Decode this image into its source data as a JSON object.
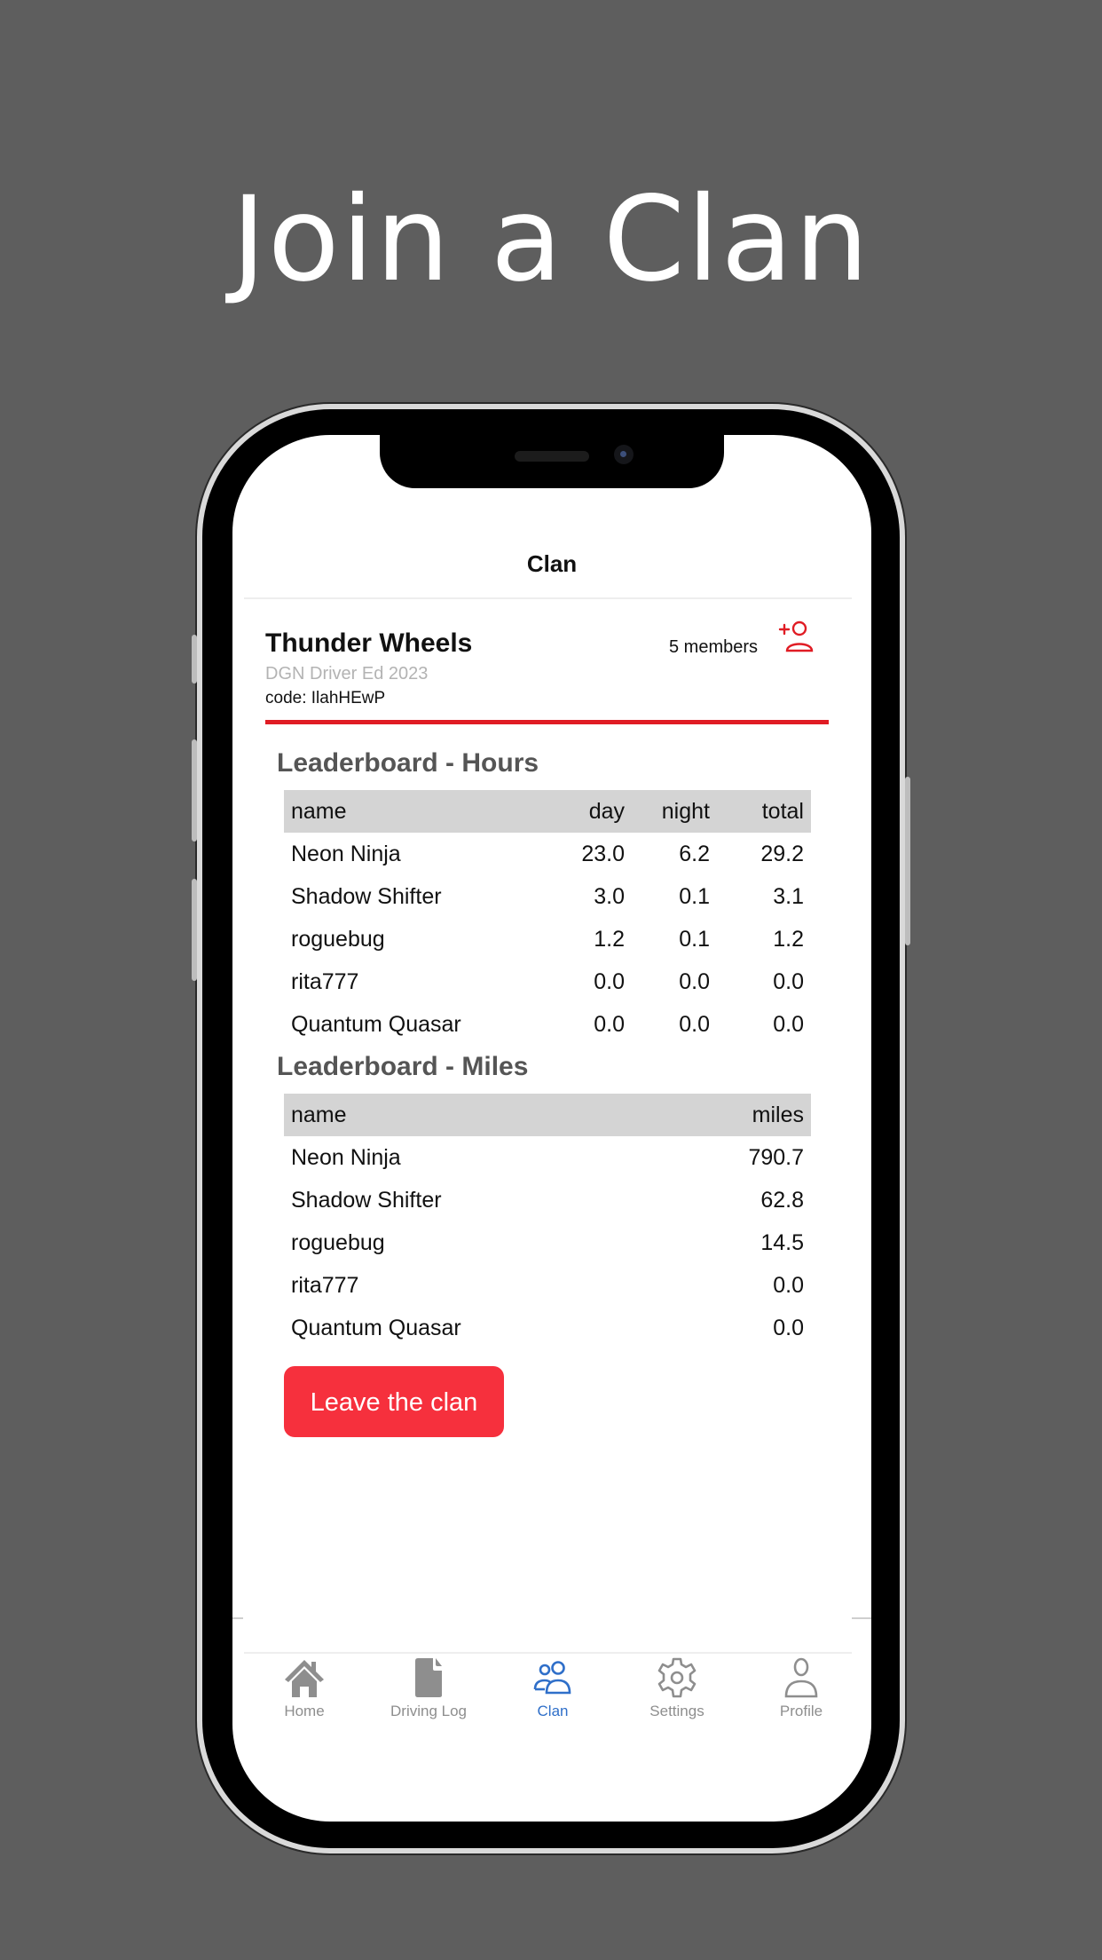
{
  "headline": "Join a Clan",
  "app": {
    "nav_title": "Clan",
    "clan": {
      "name": "Thunder Wheels",
      "subtitle": "DGN Driver Ed 2023",
      "code": "code: IlahHEwP",
      "members": "5 members",
      "add_member_icon": "add-user-icon"
    },
    "hours": {
      "title": "Leaderboard - Hours",
      "columns": [
        "name",
        "day",
        "night",
        "total"
      ],
      "rows": [
        [
          "Neon Ninja",
          "23.0",
          "6.2",
          "29.2"
        ],
        [
          "Shadow Shifter",
          "3.0",
          "0.1",
          "3.1"
        ],
        [
          "roguebug",
          "1.2",
          "0.1",
          "1.2"
        ],
        [
          "rita777",
          "0.0",
          "0.0",
          "0.0"
        ],
        [
          "Quantum Quasar",
          "0.0",
          "0.0",
          "0.0"
        ]
      ]
    },
    "miles": {
      "title": "Leaderboard - Miles",
      "columns": [
        "name",
        "miles"
      ],
      "rows": [
        [
          "Neon Ninja",
          "790.7"
        ],
        [
          "Shadow Shifter",
          "62.8"
        ],
        [
          "roguebug",
          "14.5"
        ],
        [
          "rita777",
          "0.0"
        ],
        [
          "Quantum Quasar",
          "0.0"
        ]
      ]
    },
    "leave_button": "Leave the clan",
    "tabs": [
      {
        "label": "Home",
        "icon": "home-icon",
        "active": false
      },
      {
        "label": "Driving Log",
        "icon": "document-icon",
        "active": false
      },
      {
        "label": "Clan",
        "icon": "group-icon",
        "active": true
      },
      {
        "label": "Settings",
        "icon": "gear-icon",
        "active": false
      },
      {
        "label": "Profile",
        "icon": "person-icon",
        "active": false
      }
    ]
  },
  "colors": {
    "background": "#5e5e5e",
    "accent_red": "#e01c24",
    "button_red": "#f6303d",
    "active_tab": "#2f6fc9",
    "inactive_tab": "#8e8e8e"
  }
}
